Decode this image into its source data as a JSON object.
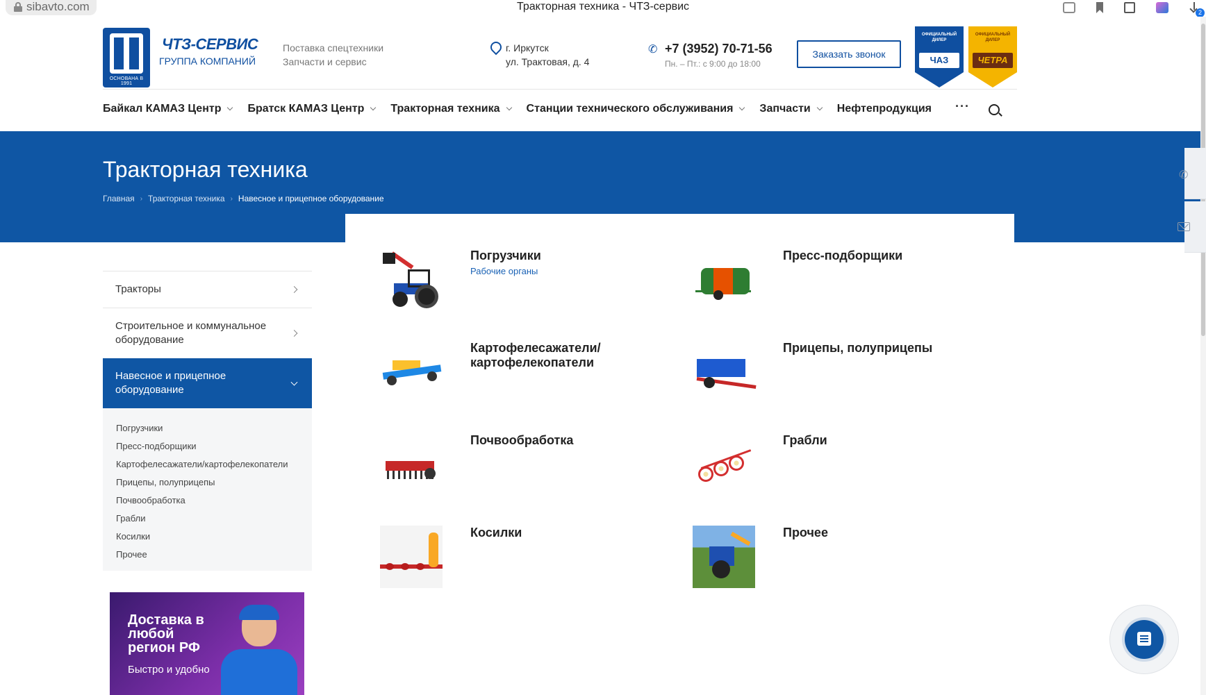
{
  "browser": {
    "url": "sibavto.com",
    "tab_title": "Тракторная техника - ЧТЗ-сервис",
    "download_count": "2"
  },
  "header": {
    "logo_name": "ЧТЗ-СЕРВИС",
    "logo_sub": "ГРУППА КОМПАНИЙ",
    "logo_since": "ОСНОВАНА В 1991",
    "tagline_1": "Поставка спецтехники",
    "tagline_2": "Запчасти и сервис",
    "city": "г. Иркутск",
    "address": "ул. Трактовая, д. 4",
    "phone": "+7 (3952) 70-71-56",
    "hours": "Пн. – Пт.: с 9:00 до 18:00",
    "callback_label": "Заказать звонок",
    "badge_chaz_top": "ОФИЦИАЛЬНЫЙ ДИЛЕР",
    "badge_chaz_brand": "ЧАЗ",
    "badge_chetra_top": "ОФИЦИАЛЬНЫЙ ДИЛЕР",
    "badge_chetra_brand": "ЧЕТРА"
  },
  "nav": {
    "items": [
      {
        "label": "Байкал КАМАЗ Центр",
        "has_dropdown": true
      },
      {
        "label": "Братск КАМАЗ Центр",
        "has_dropdown": true
      },
      {
        "label": "Тракторная техника",
        "has_dropdown": true
      },
      {
        "label": "Станции технического обслуживания",
        "has_dropdown": true
      },
      {
        "label": "Запчасти",
        "has_dropdown": true
      },
      {
        "label": "Нефтепродукция",
        "has_dropdown": false
      }
    ],
    "more_label": "···"
  },
  "banner": {
    "title": "Тракторная техника",
    "breadcrumb": [
      "Главная",
      "Тракторная техника",
      "Навесное и прицепное оборудование"
    ]
  },
  "sidebar": {
    "items": [
      {
        "label": "Тракторы"
      },
      {
        "label": "Строительное и коммунальное оборудование"
      },
      {
        "label": "Навесное и прицепное оборудование",
        "active": true
      }
    ],
    "sub_items": [
      "Погрузчики",
      "Пресс-подборщики",
      "Картофелесажатели/картофелекопатели",
      "Прицепы, полуприцепы",
      "Почвообработка",
      "Грабли",
      "Косилки",
      "Прочее"
    ]
  },
  "promo": {
    "title": "Доставка в любой регион РФ",
    "subtitle": "Быстро и удобно"
  },
  "categories": [
    {
      "name": "Погрузчики",
      "sub": "Рабочие органы",
      "icon": "loader-image"
    },
    {
      "name": "Пресс-подборщики",
      "sub": "",
      "icon": "baler-image"
    },
    {
      "name": "Картофелесажатели/ картофелекопатели",
      "sub": "",
      "icon": "potato-planter-image"
    },
    {
      "name": "Прицепы, полуприцепы",
      "sub": "",
      "icon": "trailer-image"
    },
    {
      "name": "Почвообработка",
      "sub": "",
      "icon": "tiller-image"
    },
    {
      "name": "Грабли",
      "sub": "",
      "icon": "rake-image"
    },
    {
      "name": "Косилки",
      "sub": "",
      "icon": "mower-image"
    },
    {
      "name": "Прочее",
      "sub": "",
      "icon": "tractor-image"
    }
  ],
  "colors": {
    "brand_blue": "#0f56a4",
    "badge_yellow": "#f4b400"
  }
}
